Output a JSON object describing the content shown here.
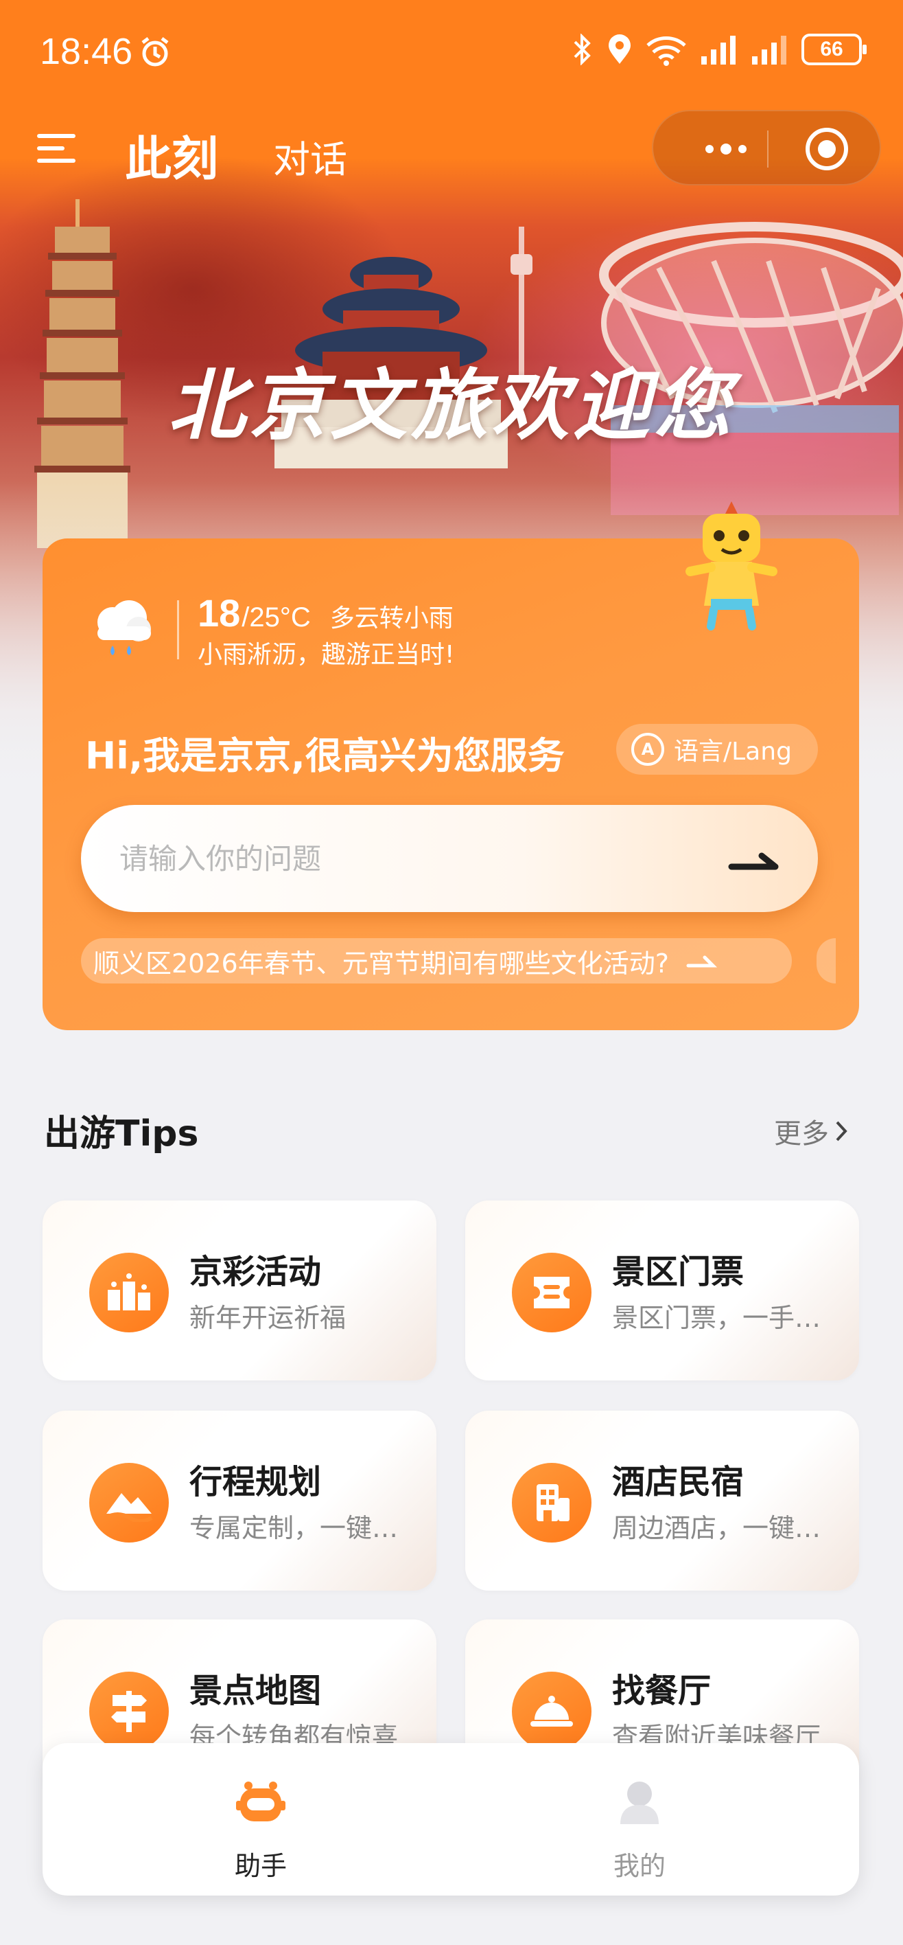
{
  "status_bar": {
    "time": "18:46",
    "battery": "66",
    "icons": [
      "alarm-icon",
      "bluetooth-icon",
      "location-icon",
      "wifi-icon",
      "signal-icon",
      "signal-icon",
      "battery-icon"
    ]
  },
  "nav": {
    "active_tab": "此刻",
    "tab": "对话"
  },
  "hero": {
    "title": "北京文旅欢迎您"
  },
  "assistant_card": {
    "weather": {
      "low": "18",
      "high": "/25°C",
      "condition": "多云转小雨",
      "tip": "小雨淅沥，趣游正当时!"
    },
    "greeting": "Hi,我是京京,很高兴为您服务",
    "language_button": "语言/Lang",
    "search": {
      "value": "",
      "placeholder": "请输入你的问题"
    },
    "suggestion": "顺义区2026年春节、元宵节期间有哪些文化活动?"
  },
  "tips": {
    "title": "出游Tips",
    "more": "更多",
    "items": [
      {
        "title": "京彩活动",
        "subtitle": "新年开运祈福",
        "icon": "podium-icon"
      },
      {
        "title": "景区门票",
        "subtitle": "景区门票，一手掌握",
        "icon": "ticket-icon"
      },
      {
        "title": "行程规划",
        "subtitle": "专属定制，一键生成",
        "icon": "mountain-icon"
      },
      {
        "title": "酒店民宿",
        "subtitle": "周边酒店，一键预订",
        "icon": "building-icon"
      },
      {
        "title": "景点地图",
        "subtitle": "每个转角都有惊喜",
        "icon": "signpost-icon"
      },
      {
        "title": "找餐厅",
        "subtitle": "查看附近美味餐厅",
        "icon": "dish-icon"
      }
    ]
  },
  "tab_bar": {
    "items": [
      {
        "label": "助手",
        "icon": "robot-icon",
        "active": true
      },
      {
        "label": "我的",
        "icon": "user-icon",
        "active": false
      }
    ]
  },
  "colors": {
    "accent": "#ff7f1c",
    "card": "#ff9a42",
    "tab_active": "#ff7a1a",
    "tab_inactive": "#999999"
  }
}
